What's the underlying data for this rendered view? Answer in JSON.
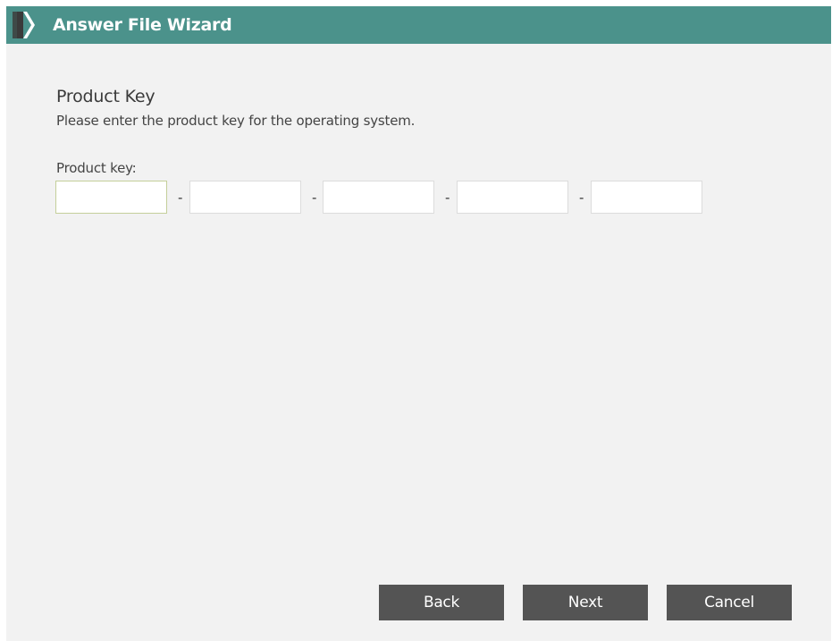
{
  "window": {
    "title": "Answer File Wizard",
    "icon": "wizard-chevron-icon"
  },
  "page": {
    "heading": "Product Key",
    "description": "Please enter the product key for the operating system."
  },
  "product_key": {
    "label": "Product key:",
    "separator": "-",
    "segments": [
      "",
      "",
      "",
      "",
      ""
    ]
  },
  "buttons": {
    "back": "Back",
    "next": "Next",
    "cancel": "Cancel"
  },
  "colors": {
    "titlebar": "#4b928b",
    "background": "#f2f2f2",
    "button": "#545454",
    "focused_border": "#c4cf9a"
  }
}
